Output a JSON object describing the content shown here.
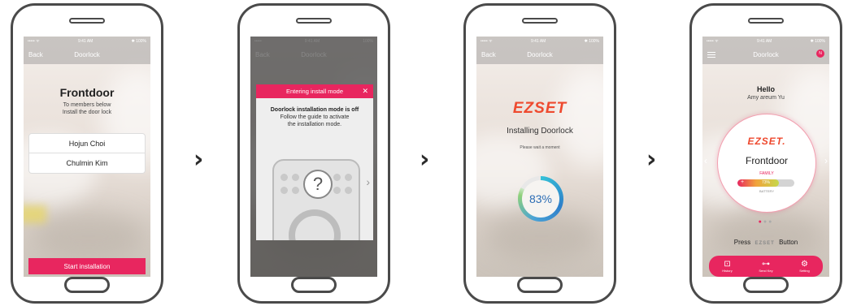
{
  "step_arrows": [
    "›",
    "›",
    "›"
  ],
  "screen1": {
    "status": {
      "left": "••••• ᯤ",
      "time": "9:41 AM",
      "right": "✱ 100%"
    },
    "nav": {
      "back": "Back",
      "title": "Doorlock"
    },
    "title": "Frontdoor",
    "subtitle_line1": "To members below",
    "subtitle_line2": "Install the door lock",
    "members": [
      "Hojun Choi",
      "Chulmin Kim"
    ],
    "start_button": "Start installation"
  },
  "screen2": {
    "status": {
      "left": "•••••",
      "time": "9:41 AM",
      "right": "100%"
    },
    "nav": {
      "back": "Back",
      "title": "Doorlock"
    },
    "modal_title": "Entering install mode",
    "modal_close": "✕",
    "modal_heading": "Doorlock installation mode is off",
    "modal_line1": "Follow the guide to activate",
    "modal_line2": "the installation mode.",
    "question_mark": "?",
    "next_chevron": "›"
  },
  "screen3": {
    "status": {
      "left": "••••• ᯤ",
      "time": "9:41 AM",
      "right": "✱ 100%"
    },
    "nav": {
      "back": "Back",
      "title": "Doorlock"
    },
    "logo": "EZSET",
    "title": "Installing Doorlock",
    "subtitle": "Please wait a moment",
    "progress_label": "83%",
    "progress": 0.83
  },
  "screen4": {
    "status": {
      "left": "••••• ᯤ",
      "time": "9:41 AM",
      "right": "✱ 100%"
    },
    "nav": {
      "title": "Doorlock",
      "badge": "N"
    },
    "hello": "Hello",
    "user_name": "Amy areum Yu",
    "logo": "EZSET.",
    "lock_name": "Frontdoor",
    "role": "FAMILY",
    "battery_label": "73%",
    "battery_level": 0.73,
    "battery_caption": "BATTERY",
    "press_prefix": "Press",
    "press_logo": "EZSET",
    "press_suffix": "Button",
    "tabs": [
      {
        "icon": "history-icon",
        "label": "History"
      },
      {
        "icon": "key-icon",
        "label": "Send Key"
      },
      {
        "icon": "settings-icon",
        "label": "Setting"
      }
    ]
  },
  "colors": {
    "accent": "#e8265f",
    "brand_logo": "#ee4a2f",
    "progress_blue": "#2c6db5"
  }
}
